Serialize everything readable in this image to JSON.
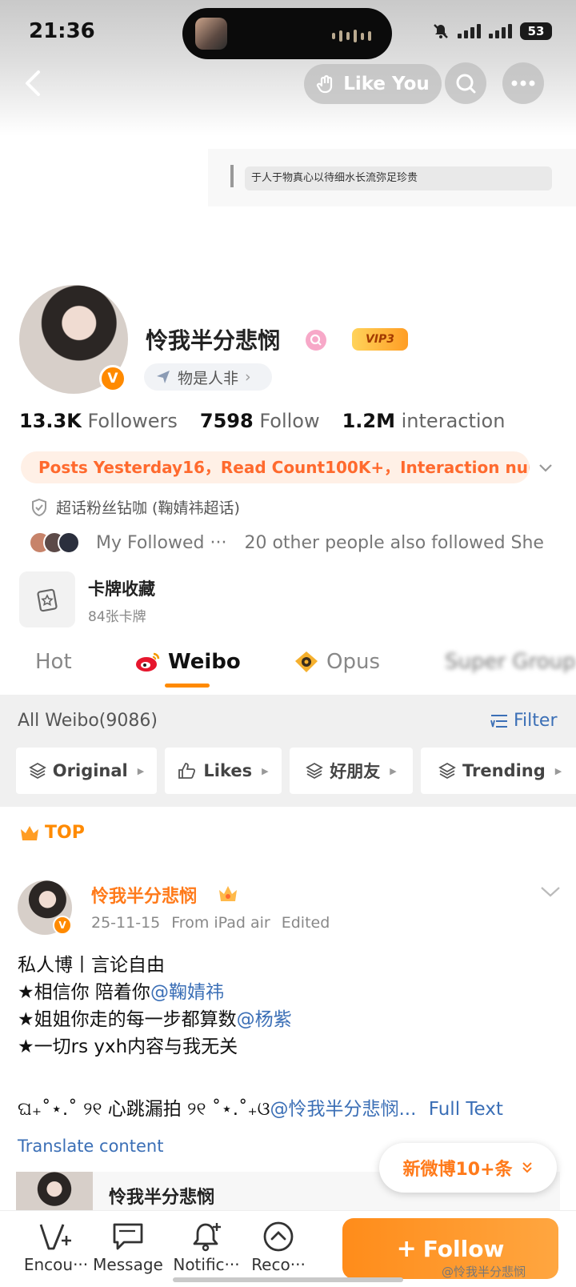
{
  "status_bar": {
    "time": "21:36",
    "battery": "53"
  },
  "header": {
    "like_you": "Like You"
  },
  "signature": "于人于物真心以待细水长流弥足珍贵",
  "profile": {
    "name": "怜我半分悲悯",
    "vip": "VIP3",
    "verified_badge": "V",
    "tag": "物是人非",
    "followers_count": "13.3K",
    "followers_label": "Followers",
    "follow_count": "7598",
    "follow_label": "Follow",
    "interaction_count": "1.2M",
    "interaction_label": "interaction",
    "posts_banner": "Posts Yesterday16，Read Count100K+，Interaction num···",
    "superfan": "超话粉丝钻咖 (鞠婧祎超话)",
    "my_followed": "My Followed ···",
    "others_followed": "20 other people also followed She",
    "card_title": "卡牌收藏",
    "card_sub": "84张卡牌"
  },
  "tabs": [
    "Hot",
    "Weibo",
    "Opus",
    "Super Group"
  ],
  "feed": {
    "all_weibo": "All Weibo(9086)",
    "filter": "Filter",
    "chips": [
      "Original",
      "Likes",
      "好朋友",
      "Trending"
    ]
  },
  "post": {
    "top_label": "TOP",
    "author": "怜我半分悲悯",
    "date": "25-11-15",
    "source": "From iPad air",
    "edited": "Edited",
    "line1": "私人博丨言论自由",
    "line2_text": "★相信你 陪着你",
    "line2_mention": "@鞠婧祎",
    "line3_text": "★姐姐你走的每一步都算数",
    "line3_mention": "@杨紫",
    "line4": "★一切rs yxh内容与我无关",
    "line5_text": "ଘ₊˚⋆.˚ ୨୧ 心跳漏拍 ୨୧ ˚⋆.˚₊ଓ",
    "line5_mention": "@怜我半分悲悯...",
    "full_text": "Full Text",
    "translate": "Translate content",
    "quoted_name": "怜我半分悲悯"
  },
  "new_posts": "新微博10+条",
  "bottom_nav": [
    {
      "label": "Encou···",
      "icon": "pen-plus-icon"
    },
    {
      "label": "Message",
      "icon": "chat-bubble-icon"
    },
    {
      "label": "Notific···",
      "icon": "bell-plus-icon"
    },
    {
      "label": "Reco···",
      "icon": "chevron-up-circle-icon"
    }
  ],
  "follow_button": "Follow",
  "watermark": "@怜我半分悲悯",
  "colors": {
    "accent": "#ff8a00",
    "link": "#3b6fb6",
    "banner_text": "#ff6a2e"
  }
}
